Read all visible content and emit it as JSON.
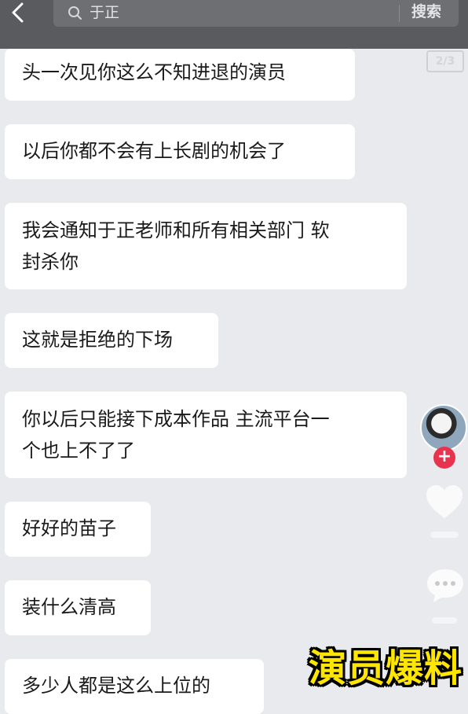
{
  "search": {
    "query": "于正",
    "button_label": "搜索"
  },
  "page_indicator": "2/3",
  "messages": [
    {
      "lines": [
        "头一次见你这么不知进退的演员"
      ]
    },
    {
      "lines": [
        "以后你都不会有上长剧的机会了"
      ]
    },
    {
      "lines": [
        "我会通知于正老师和所有相关部门 软",
        "封杀你"
      ]
    },
    {
      "lines": [
        "这就是拒绝的下场"
      ]
    },
    {
      "lines": [
        "你以后只能接下成本作品 主流平台一",
        "个也上不了了"
      ]
    },
    {
      "lines": [
        "好好的苗子"
      ]
    },
    {
      "lines": [
        "装什么清高"
      ]
    },
    {
      "lines": [
        "多少人都是这么上位的"
      ]
    }
  ],
  "side_actions": {
    "follow_label": "+",
    "icons": [
      "back-arrow-icon",
      "search-icon",
      "heart-icon",
      "comment-icon"
    ]
  },
  "watermark": "演员爆料",
  "colors": {
    "topbar": "#5a5b5f",
    "background": "#e9eaee",
    "bubble": "#ffffff",
    "follow": "#e8334f",
    "watermark": "#ffe600"
  }
}
